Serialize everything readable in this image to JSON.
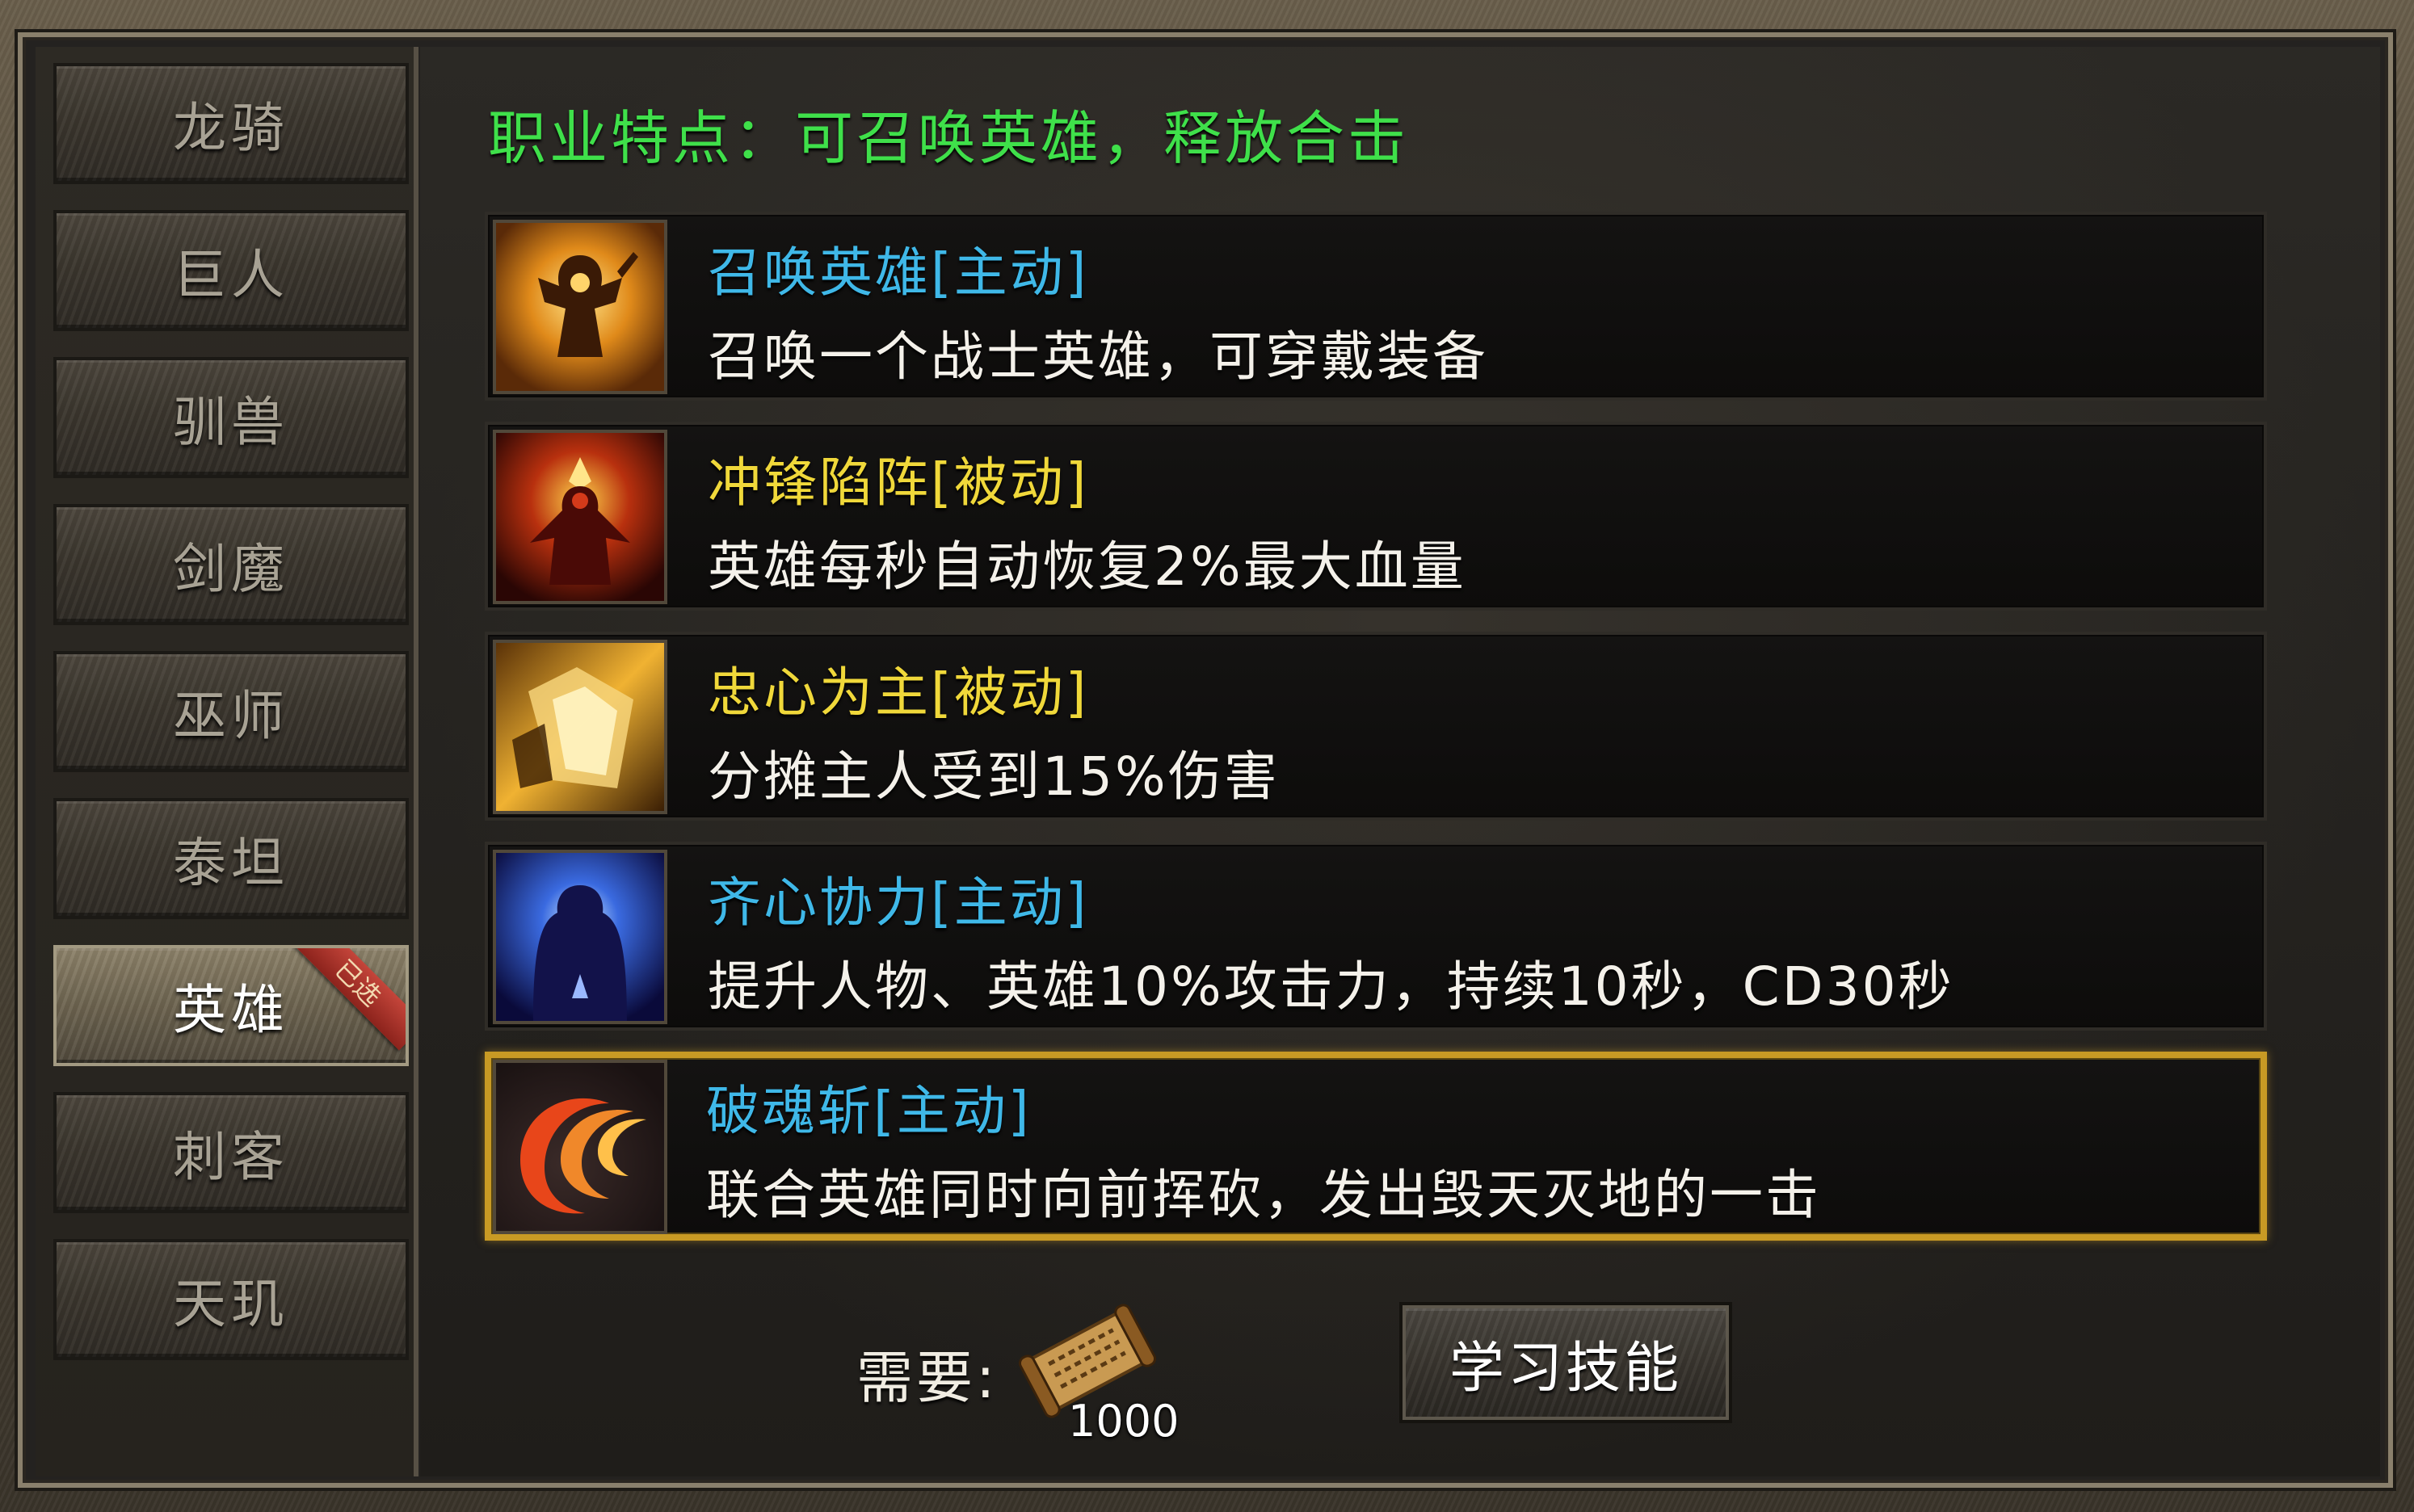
{
  "sidebar": {
    "tabs": [
      {
        "label": "龙骑"
      },
      {
        "label": "巨人"
      },
      {
        "label": "驯兽"
      },
      {
        "label": "剑魔"
      },
      {
        "label": "巫师"
      },
      {
        "label": "泰坦"
      },
      {
        "label": "英雄",
        "active": true,
        "badge": "已选"
      },
      {
        "label": "刺客"
      },
      {
        "label": "天玑"
      }
    ]
  },
  "main": {
    "trait": "职业特点：可召唤英雄，释放合击",
    "skills": [
      {
        "name": "召唤英雄[主动]",
        "desc": "召唤一个战士英雄，可穿戴装备",
        "name_color": "#3fb8e8",
        "icon": "summon-hero-icon"
      },
      {
        "name": "冲锋陷阵[被动]",
        "desc": "英雄每秒自动恢复2%最大血量",
        "name_color": "#f0d83a",
        "icon": "charge-icon"
      },
      {
        "name": "忠心为主[被动]",
        "desc": "分摊主人受到15%伤害",
        "name_color": "#f0d83a",
        "icon": "loyalty-icon"
      },
      {
        "name": "齐心协力[主动]",
        "desc": "提升人物、英雄10%攻击力，持续10秒，CD30秒",
        "name_color": "#3fb8e8",
        "icon": "teamwork-icon"
      },
      {
        "name": "破魂斩[主动]",
        "desc": "联合英雄同时向前挥砍，发出毁天灭地的一击",
        "name_color": "#3fb8e8",
        "icon": "soul-break-icon",
        "selected": true
      }
    ],
    "need": {
      "label": "需要:",
      "count": "1000",
      "icon": "skill-book-scroll-icon"
    },
    "learn_button": "学习技能"
  }
}
